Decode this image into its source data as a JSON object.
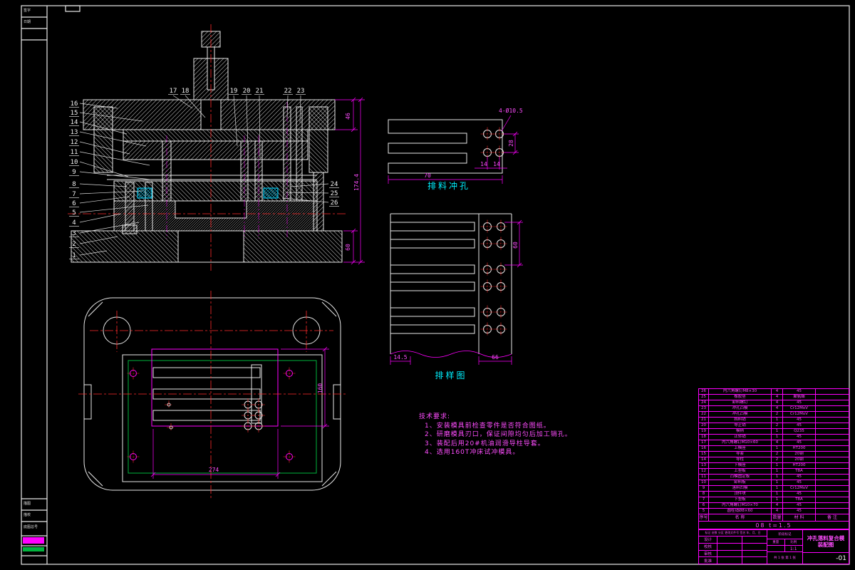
{
  "colors": {
    "line": "#e8e8e8",
    "dim": "#ff00ff",
    "accent": "#00f0ff",
    "center": "#ff2b2b",
    "green": "#00b33c"
  },
  "section_view": {
    "callouts_left": [
      "16",
      "15",
      "14",
      "13",
      "12",
      "11",
      "10",
      "9",
      "8",
      "7",
      "6",
      "5",
      "4",
      "3",
      "2",
      "1"
    ],
    "callouts_top": [
      "17",
      "18",
      "19",
      "20",
      "21",
      "22",
      "23"
    ],
    "callouts_right": [
      "24",
      "25",
      "26"
    ],
    "dims": {
      "upper_plate": "46",
      "total": "174.4",
      "lower_plate": "60"
    }
  },
  "plan_view": {
    "dims": {
      "width": "274",
      "height": "160"
    }
  },
  "punch_detail": {
    "label": "排料冲孔",
    "dims": {
      "holes": "4-Ø10.5",
      "pitch": "28",
      "width": "70",
      "a": "14",
      "b": "14"
    }
  },
  "strip_layout": {
    "label": "排样图",
    "dims": {
      "step": "60",
      "margin": "14.5",
      "width": "66"
    }
  },
  "tech_notes": {
    "title": "技术要求:",
    "items": [
      "1、安装模具前检查零件是否符合图纸。",
      "2、研磨模具刃口，保证间隙均匀后加工销孔。",
      "3、装配后用20#机油润滑导柱导套。",
      "4、选用160T冲床试冲模具。"
    ]
  },
  "parts_table": {
    "header": [
      "序号",
      "名  称",
      "数量",
      "材  料",
      "备  注"
    ],
    "rows": [
      [
        "26",
        "内六角螺钉M8×30",
        "4",
        "45",
        ""
      ],
      [
        "25",
        "橡胶垫",
        "4",
        "聚氨酯",
        ""
      ],
      [
        "24",
        "卸料螺钉",
        "4",
        "45",
        ""
      ],
      [
        "23",
        "冲孔凸模",
        "4",
        "Cr12MoV",
        ""
      ],
      [
        "22",
        "冲孔凸模",
        "2",
        "Cr12MoV",
        ""
      ],
      [
        "21",
        "挡料销",
        "1",
        "45",
        ""
      ],
      [
        "20",
        "导正销",
        "2",
        "45",
        ""
      ],
      [
        "19",
        "模柄",
        "1",
        "Q235",
        ""
      ],
      [
        "18",
        "止转销",
        "1",
        "45",
        ""
      ],
      [
        "17",
        "内六角螺钉M10×60",
        "4",
        "45",
        ""
      ],
      [
        "16",
        "上模座",
        "1",
        "HT200",
        ""
      ],
      [
        "15",
        "导套",
        "2",
        "20钢",
        ""
      ],
      [
        "14",
        "导柱",
        "2",
        "20钢",
        ""
      ],
      [
        "13",
        "下模座",
        "1",
        "HT200",
        ""
      ],
      [
        "12",
        "上垫板",
        "1",
        "T8A",
        ""
      ],
      [
        "11",
        "凸模固定板",
        "1",
        "45",
        ""
      ],
      [
        "10",
        "卸料板",
        "1",
        "45",
        ""
      ],
      [
        "9",
        "落料凹模",
        "1",
        "Cr12MoV",
        ""
      ],
      [
        "8",
        "顶件块",
        "1",
        "45",
        ""
      ],
      [
        "7",
        "下垫板",
        "1",
        "T8A",
        ""
      ],
      [
        "6",
        "内六角螺钉M10×70",
        "4",
        "45",
        ""
      ],
      [
        "5",
        "圆柱销Ø8×60",
        "4",
        "45",
        ""
      ]
    ],
    "material_row": "08  t=1.5"
  },
  "title_block": {
    "roles": [
      "设计",
      "校核",
      "审核",
      "批准"
    ],
    "header_row": "标记 处数 分区 更改文件号 签名 年、月、日",
    "stage_label": "阶段标记",
    "weight_label": "重量",
    "scale_label": "比例",
    "scale_value": "1:1",
    "title_line1": "冲孔落料复合模",
    "title_line2": "装配图",
    "sheet_info": "共 1 张 第 1 张",
    "drawing_no": "-01"
  },
  "margin": {
    "top_rows": [
      "签字",
      "日期"
    ],
    "bottom_rows": [
      "描图",
      "描校",
      "底图总号"
    ]
  }
}
